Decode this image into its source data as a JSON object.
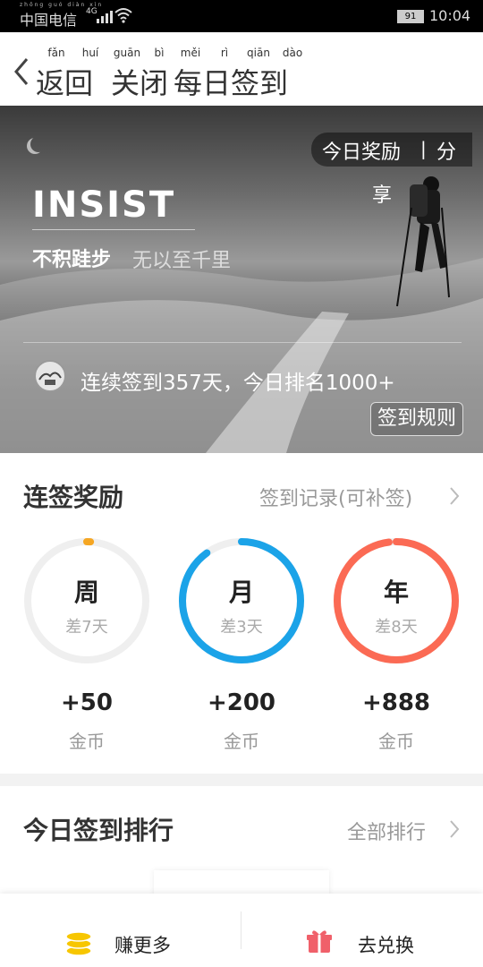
{
  "status_bar": {
    "carrier": "中国电信",
    "carrier_pinyin": "zhōng guó diàn xìn",
    "network": "4G",
    "battery": "91",
    "time": "10:04"
  },
  "header": {
    "back_label": "返回",
    "back_pinyin": [
      "fǎn",
      "huí"
    ],
    "close_label": "关闭",
    "close_pinyin": [
      "guān",
      "bì"
    ],
    "title": "每日签到",
    "title_pinyin": [
      "měi",
      "rì",
      "qiān",
      "dào"
    ]
  },
  "banner": {
    "headline": "INSIST",
    "motto_bold": "不积跬步",
    "motto_light": "无以至千里",
    "today_reward": "今日奖励",
    "separator": "|",
    "share_1": "分",
    "share_2": "享",
    "streak_text": "连续签到357天，今日排名1000+",
    "rules_button": "签到规则"
  },
  "bonus": {
    "title": "连签奖励",
    "record_link": "签到记录(可补签)",
    "rings": [
      {
        "name": "周",
        "sub": "差7天",
        "coins": "+50",
        "unit": "金币",
        "color": "#f5a623",
        "progress": 0.0
      },
      {
        "name": "月",
        "sub": "差3天",
        "coins": "+200",
        "unit": "金币",
        "color": "#1ba3e8",
        "progress": 0.9
      },
      {
        "name": "年",
        "sub": "差8天",
        "coins": "+888",
        "unit": "金币",
        "color": "#fb6a54",
        "progress": 0.98
      }
    ]
  },
  "ranking": {
    "title": "今日签到排行",
    "all_link": "全部排行"
  },
  "bottom_bar": {
    "earn_more": "赚更多",
    "redeem": "去兑换",
    "coin_color": "#f7c600",
    "gift_color": "#f0606a"
  }
}
